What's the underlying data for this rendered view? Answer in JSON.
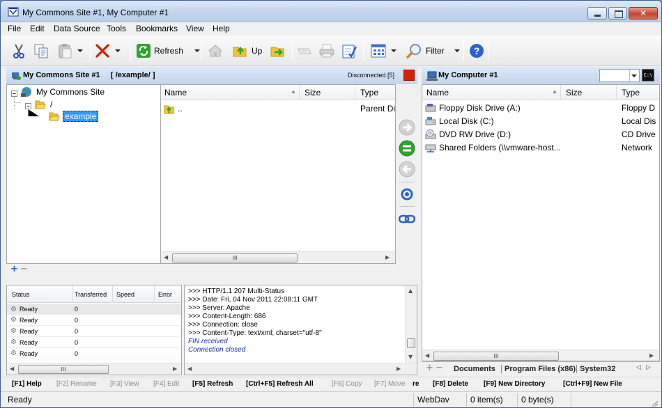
{
  "window": {
    "title": "My Commons Site #1, My Computer #1"
  },
  "menu": [
    "File",
    "Edit",
    "Data Source",
    "Tools",
    "Bookmarks",
    "View",
    "Help"
  ],
  "toolbar": {
    "refresh_label": "Refresh",
    "up_label": "Up",
    "filter_label": "Filter"
  },
  "left_pane": {
    "title": "My Commons Site #1",
    "path": "[ /example/ ]",
    "status": "Disconnected [5]",
    "tree": [
      {
        "label": "My Commons Site",
        "level": 0
      },
      {
        "label": "/",
        "level": 1
      },
      {
        "label": "example",
        "level": 2
      }
    ],
    "columns": [
      "Name",
      "Size",
      "Type"
    ],
    "rows": [
      {
        "name": "..",
        "size": "",
        "type": "Parent Di"
      }
    ]
  },
  "right_pane": {
    "title": "My Computer #1",
    "columns": [
      "Name",
      "Size",
      "Type"
    ],
    "rows": [
      {
        "name": "Floppy Disk Drive (A:)",
        "type": "Floppy D"
      },
      {
        "name": "Local Disk (C:)",
        "type": "Local Dis"
      },
      {
        "name": "DVD RW Drive (D:)",
        "type": "CD Drive"
      },
      {
        "name": "Shared Folders (\\\\vmware-host...",
        "type": "Network"
      }
    ],
    "tabs": [
      "Documents",
      "Program Files (x86)",
      "System32"
    ]
  },
  "queue": {
    "columns": [
      "Status",
      "Transferred",
      "Speed",
      "Error"
    ],
    "rows": [
      {
        "status": "Ready",
        "transferred": "0"
      },
      {
        "status": "Ready",
        "transferred": "0"
      },
      {
        "status": "Ready",
        "transferred": "0"
      },
      {
        "status": "Ready",
        "transferred": "0"
      },
      {
        "status": "Ready",
        "transferred": "0"
      }
    ]
  },
  "log": {
    "lines": [
      ">>> HTTP/1.1 207 Multi-Status",
      ">>> Date: Fri, 04 Nov 2011 22:08:11 GMT",
      ">>> Server: Apache",
      ">>> Content-Length: 686",
      ">>> Connection: close",
      ">>> Content-Type: text/xml; charset=\"utf-8\""
    ],
    "notes": [
      "FIN received",
      "Connection closed"
    ]
  },
  "function_keys": [
    {
      "label": "[F1] Help",
      "enabled": true
    },
    {
      "label": "[F2] Rename",
      "enabled": false
    },
    {
      "label": "[F3] View",
      "enabled": false
    },
    {
      "label": "[F4] Edit",
      "enabled": false
    },
    {
      "label": "[F5] Refresh",
      "enabled": true
    },
    {
      "label": "[Ctrl+F5] Refresh All",
      "enabled": true
    },
    {
      "label": "[F6] Copy",
      "enabled": false
    },
    {
      "label": "[F7] Move",
      "enabled": false
    },
    {
      "label": "re",
      "enabled": true
    },
    {
      "label": "[F8] Delete",
      "enabled": true
    },
    {
      "label": "[F9] New Directory",
      "enabled": true
    },
    {
      "label": "[Ctrl+F9] New File",
      "enabled": true
    }
  ],
  "status_bar": {
    "state": "Ready",
    "protocol": "WebDav",
    "items": "0 item(s)",
    "bytes": "0 byte(s)"
  },
  "colors": {
    "accent_red": "#d81e05",
    "accent_green": "#2ea52e",
    "header_blue": "#c1d5ee",
    "help_blue": "#2b63c8"
  }
}
